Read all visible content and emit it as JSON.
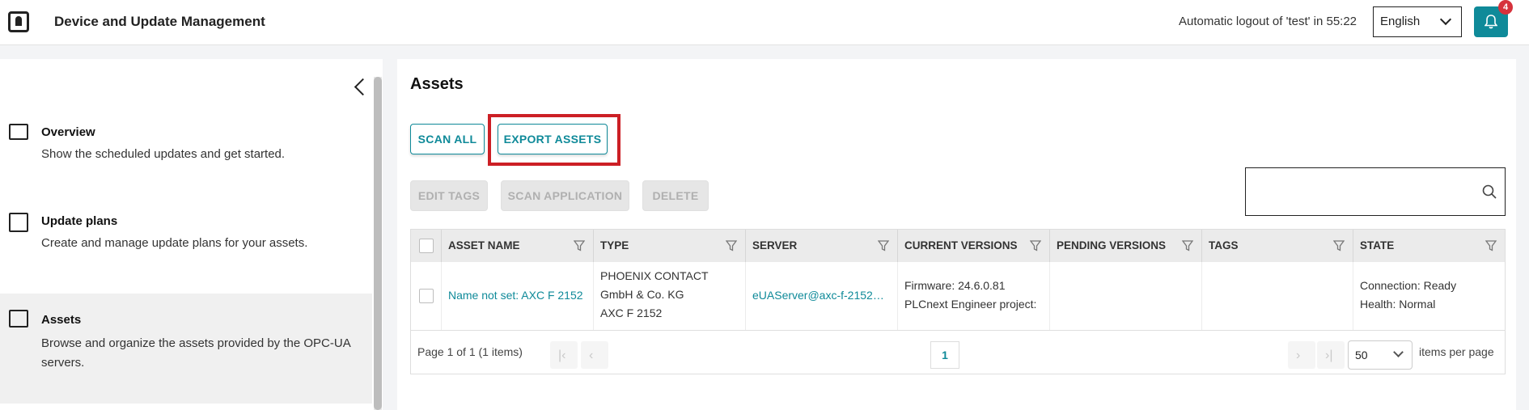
{
  "header": {
    "title": "Device and Update Management",
    "logout_text": "Automatic logout of 'test' in 55:22",
    "language": "English",
    "notification_count": "4"
  },
  "sidebar": {
    "items": [
      {
        "title": "Overview",
        "description": "Show the scheduled updates and get started.",
        "icon": "checklist-icon"
      },
      {
        "title": "Update plans",
        "description": "Create and manage update plans for your assets.",
        "icon": "calendar-icon"
      },
      {
        "title": "Assets",
        "description": "Browse and organize the assets provided by the OPC-UA servers.",
        "icon": "asset-icon"
      }
    ]
  },
  "main": {
    "title": "Assets",
    "buttons": {
      "scan_all": "SCAN ALL",
      "export_assets": "EXPORT ASSETS",
      "edit_tags": "EDIT TAGS",
      "scan_application": "SCAN APPLICATION",
      "delete": "DELETE"
    },
    "search_placeholder": "",
    "table": {
      "columns": [
        "ASSET NAME",
        "TYPE",
        "SERVER",
        "CURRENT VERSIONS",
        "PENDING VERSIONS",
        "TAGS",
        "STATE"
      ],
      "rows": [
        {
          "asset_name": "Name not set: AXC F 2152",
          "type_line1": "PHOENIX CONTACT",
          "type_line2": "GmbH & Co. KG",
          "type_line3": "AXC F 2152",
          "server": "eUAServer@axc-f-2152…",
          "current_line1": "Firmware: 24.6.0.81",
          "current_line2": "PLCnext Engineer project:",
          "pending": "",
          "tags": "",
          "state_line1": "Connection: Ready",
          "state_line2": "Health: Normal"
        }
      ]
    },
    "pager": {
      "summary": "Page 1 of 1 (1 items)",
      "current_page": "1",
      "per_page": "50",
      "per_page_label": "items per page"
    }
  },
  "colors": {
    "accent": "#0f8a99",
    "highlight": "#cc1f25",
    "badge": "#d6323c"
  }
}
